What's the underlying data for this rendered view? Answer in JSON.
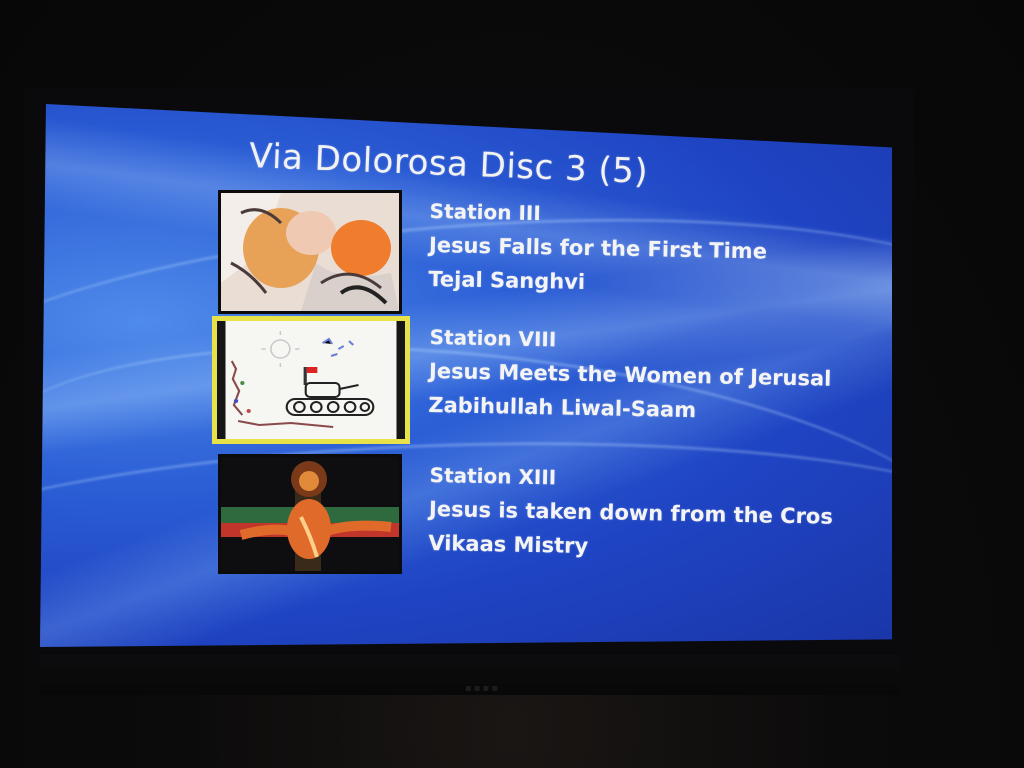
{
  "menu": {
    "title": "Via Dolorosa Disc 3 (5)",
    "items": [
      {
        "station": "Station III",
        "work": "Jesus Falls for the First Time",
        "artist": "Tejal Sanghvi",
        "selected": false,
        "thumb_icon": "painting-thumbnail"
      },
      {
        "station": "Station VIII",
        "work": "Jesus Meets the Women of Jerusal",
        "artist": "Zabihullah Liwal-Saam",
        "selected": true,
        "thumb_icon": "tank-drawing-thumbnail"
      },
      {
        "station": "Station XIII",
        "work": "Jesus is taken down from the Cros",
        "artist": "Vikaas Mistry",
        "selected": false,
        "thumb_icon": "cross-figure-thumbnail"
      }
    ]
  },
  "colors": {
    "background_blue": "#2c5fd6",
    "text": "#f4f4f4",
    "selection_highlight": "#e8e24a"
  }
}
